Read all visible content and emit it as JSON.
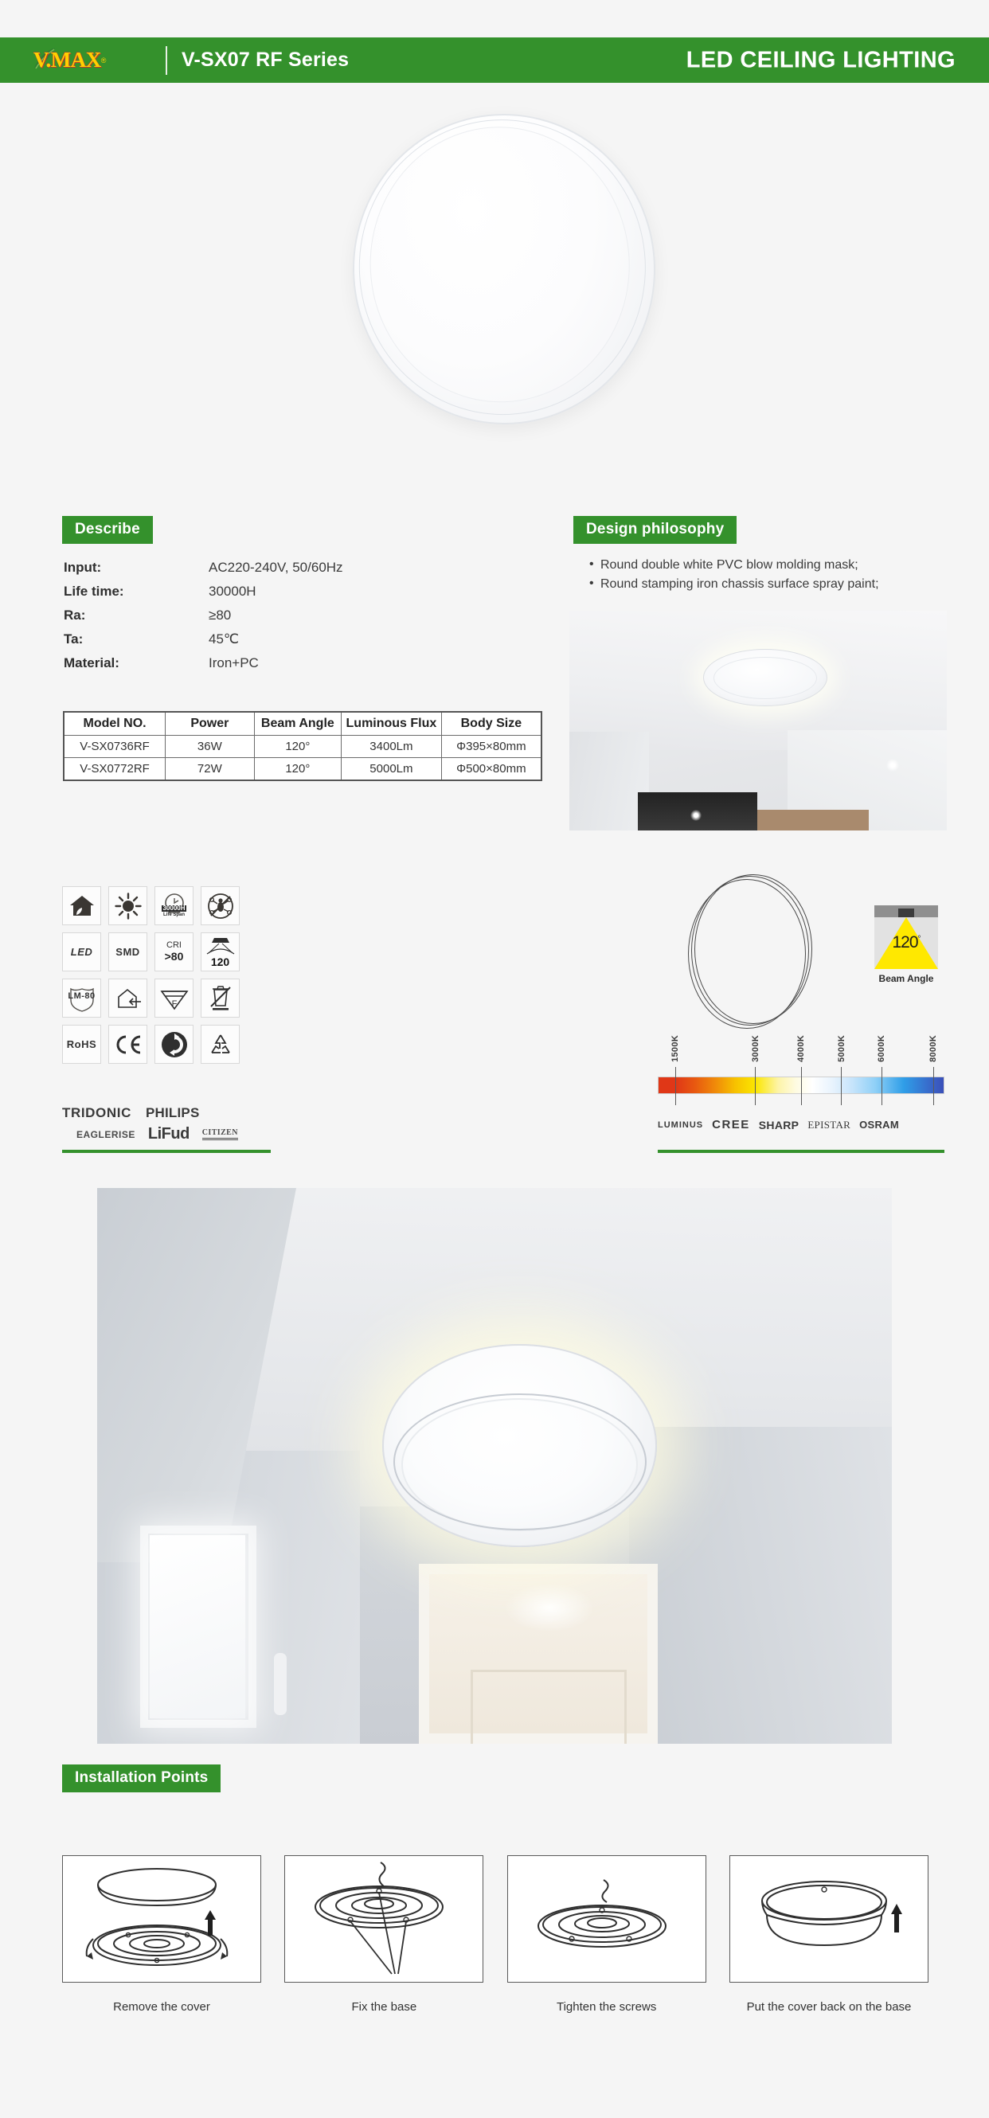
{
  "header": {
    "logo_text": "V.MAX",
    "logo_mark": "vmax-leaf-logo",
    "series": "V-SX07 RF Series",
    "title": "LED CEILING LIGHTING",
    "green": "#34912c"
  },
  "hero": {
    "product_alt": "round-led-ceiling-lamp"
  },
  "describe": {
    "badge": "Describe",
    "rows": [
      {
        "key": "Input:",
        "value": "AC220-240V, 50/60Hz"
      },
      {
        "key": "Life time:",
        "value": "30000H"
      },
      {
        "key": "Ra:",
        "value": "≥80"
      },
      {
        "key": "Ta:",
        "value": "45℃"
      },
      {
        "key": "Material:",
        "value": "Iron+PC"
      }
    ]
  },
  "spec_table": {
    "headers": [
      "Model NO.",
      "Power",
      "Beam Angle",
      "Luminous Flux",
      "Body Size"
    ],
    "rows": [
      [
        "V-SX0736RF",
        "36W",
        "120°",
        "3400Lm",
        "Φ395×80mm"
      ],
      [
        "V-SX0772RF",
        "72W",
        "120°",
        "5000Lm",
        "Φ500×80mm"
      ]
    ]
  },
  "design": {
    "badge": "Design philosophy",
    "bullets": [
      "Round double white PVC blow molding mask;",
      "Round stamping iron chassis surface spray paint;"
    ],
    "photo_alt": "ceiling-lamp-installed-in-room"
  },
  "icons": [
    {
      "name": "eco-house-icon",
      "label": ""
    },
    {
      "name": "sun-brightness-icon",
      "label": ""
    },
    {
      "name": "lifespan-30000h-icon",
      "label": "30000H",
      "sub": "Life Span"
    },
    {
      "name": "no-insects-icon",
      "label": ""
    },
    {
      "name": "led-icon",
      "label": "LED"
    },
    {
      "name": "smd-icon",
      "label": "SMD"
    },
    {
      "name": "cri-icon",
      "label": "CRI",
      "sub": ">80"
    },
    {
      "name": "beam-angle-120-icon",
      "label": "120"
    },
    {
      "name": "lm-80-icon",
      "label": "LM-80"
    },
    {
      "name": "indoor-use-icon",
      "label": ""
    },
    {
      "name": "f-mark-icon",
      "label": "F"
    },
    {
      "name": "weee-bin-icon",
      "label": ""
    },
    {
      "name": "rohs-icon",
      "label": "RoHS"
    },
    {
      "name": "ce-mark-icon",
      "label": "CE"
    },
    {
      "name": "green-dot-icon",
      "label": ""
    },
    {
      "name": "recycle-icon",
      "label": ""
    }
  ],
  "driver_brands": {
    "row1": [
      "TRIDONIC",
      "PHILIPS"
    ],
    "row2": [
      "EAGLERISE",
      "LiFud",
      "CITIZEN"
    ]
  },
  "chip_brands": [
    "LUMINUS",
    "CREE",
    "SHARP",
    "EPISTAR",
    "OSRAM"
  ],
  "beam": {
    "value": "120",
    "degree": "°",
    "caption": "Beam Angle"
  },
  "cct": {
    "ticks": [
      "1500K",
      "3000K",
      "4000K",
      "5000K",
      "6000K",
      "8000K"
    ],
    "positions": [
      6,
      34,
      50,
      64,
      78,
      96
    ]
  },
  "outline": {
    "alt": "product-outline-drawing"
  },
  "hall_photo": {
    "alt": "hallway-with-ceiling-lamp"
  },
  "installation": {
    "badge": "Installation Points",
    "steps": [
      {
        "caption": "Remove the cover",
        "icon": "remove-cover-diagram"
      },
      {
        "caption": "Fix the base",
        "icon": "fix-base-diagram"
      },
      {
        "caption": "Tighten the screws",
        "icon": "tighten-screws-diagram"
      },
      {
        "caption": "Put the cover back on the base",
        "icon": "replace-cover-diagram"
      }
    ]
  }
}
